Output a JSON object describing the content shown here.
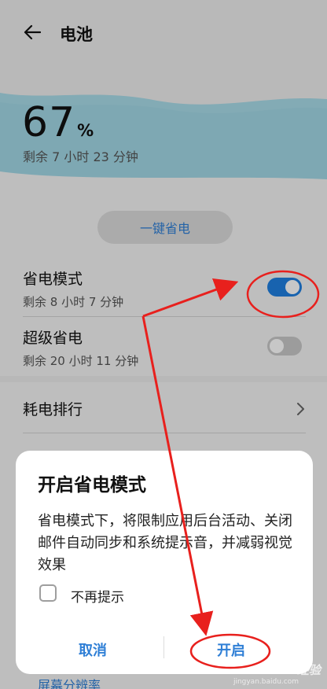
{
  "header": {
    "title": "电池",
    "battery_percent": "67",
    "percent_sign": "%",
    "remaining": "剩余 7 小时 23 分钟",
    "wave_color": "#a8dbe8"
  },
  "onekey": {
    "label": "一键省电"
  },
  "settings": {
    "power_saving": {
      "title": "省电模式",
      "subtitle": "剩余 8 小时 7 分钟",
      "enabled": true
    },
    "super_saving": {
      "title": "超级省电",
      "subtitle": "剩余 20 小时 11 分钟",
      "enabled": false
    },
    "usage_ranking": {
      "title": "耗电排行"
    }
  },
  "dialog": {
    "title": "开启省电模式",
    "message": "省电模式下，将限制应用后台活动、关闭邮件自动同步和系统提示音，并减弱视觉效果",
    "checkbox_label": "不再提示",
    "cancel_label": "取消",
    "open_label": "开启"
  },
  "below_dialog": {
    "text": "屏幕分辨率"
  },
  "watermark": {
    "text": "Baidu 经验",
    "url": "jingyan.baidu.com"
  },
  "colors": {
    "accent": "#2f7fd6",
    "toggle_on": "#1f7fe0",
    "annotation": "#e8201d"
  }
}
